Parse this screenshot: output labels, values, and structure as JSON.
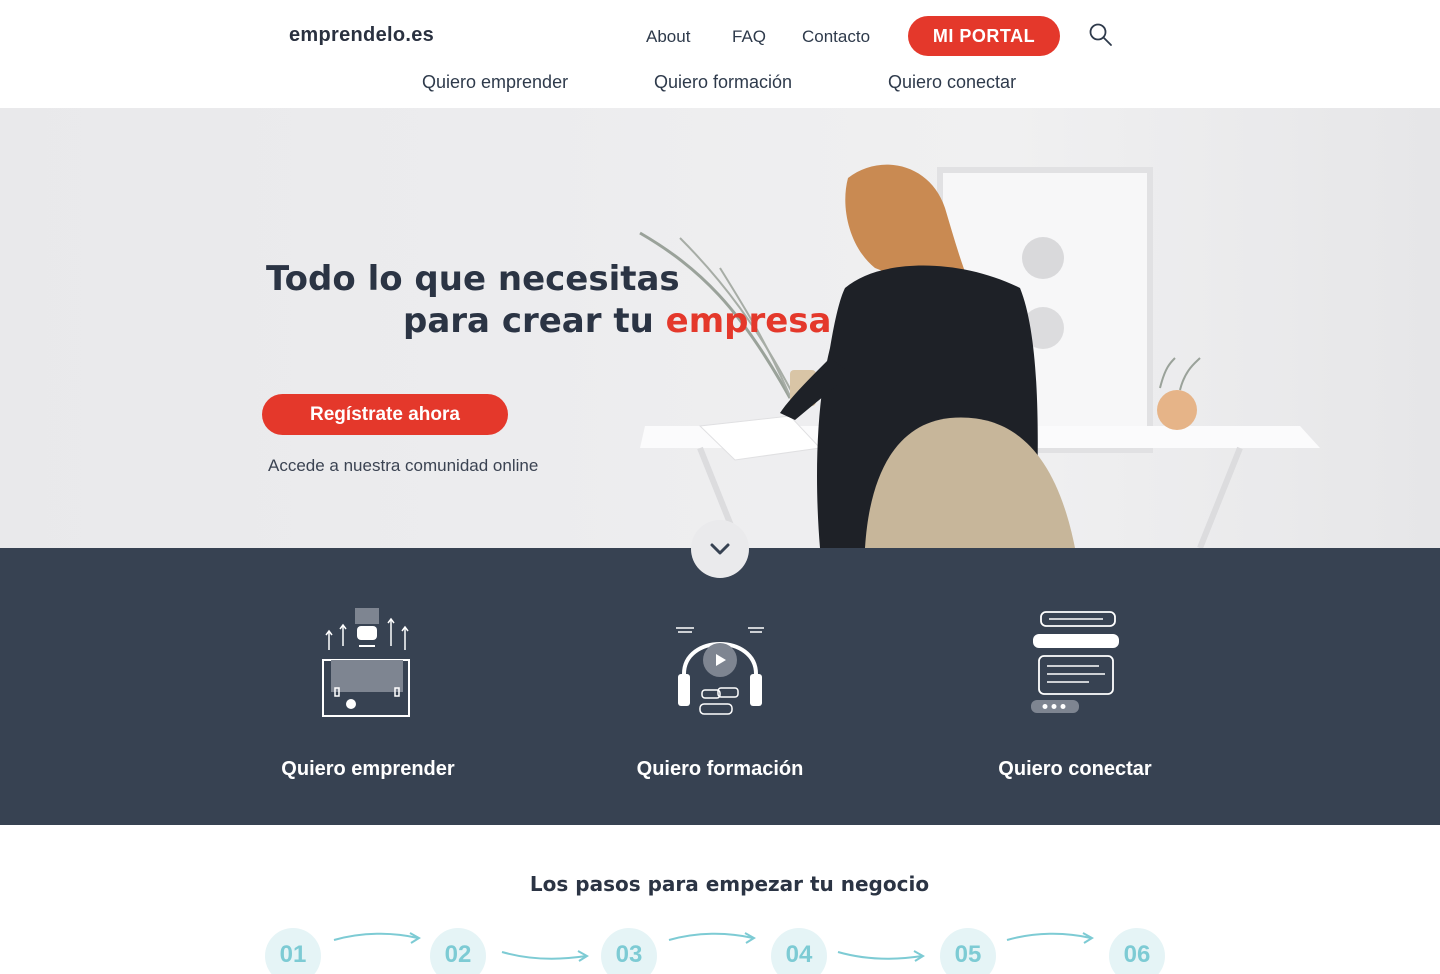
{
  "header": {
    "logo": "emprendelo.es",
    "nav": [
      "About",
      "FAQ",
      "Contacto"
    ],
    "portal_label": "MI PORTAL",
    "sub_nav": [
      "Quiero emprender",
      "Quiero formación",
      "Quiero conectar"
    ]
  },
  "hero": {
    "title_line1": "Todo lo que necesitas",
    "title_line2": "para crear tu ",
    "title_accent": "empresa",
    "cta_label": "Regístrate ahora",
    "cta_subtext": "Accede a nuestra comunidad online"
  },
  "categories": [
    {
      "label": "Quiero emprender",
      "icon": "briefcase-growth-icon"
    },
    {
      "label": "Quiero formación",
      "icon": "headphones-play-icon"
    },
    {
      "label": "Quiero conectar",
      "icon": "chat-messages-icon"
    }
  ],
  "steps": {
    "title": "Los pasos para empezar tu negocio",
    "numbers": [
      "01",
      "02",
      "03",
      "04",
      "05",
      "06"
    ]
  },
  "colors": {
    "accent": "#e4382b",
    "dark_band": "#374252",
    "step_text": "#7dcbd4",
    "step_bg": "#e5f4f6"
  }
}
